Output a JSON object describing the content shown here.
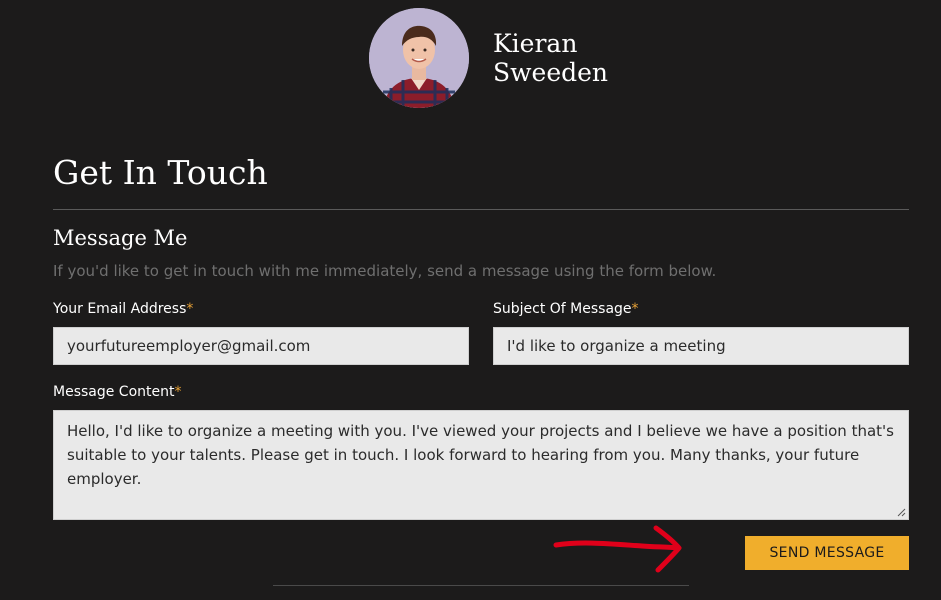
{
  "profile": {
    "name": "Kieran Sweeden"
  },
  "contact": {
    "title": "Get In Touch",
    "subtitle": "Message Me",
    "intro": "If you'd like to get in touch with me immediately, send a message using the form below.",
    "required_marker": "*",
    "email": {
      "label": "Your Email Address",
      "value": "yourfutureemployer@gmail.com"
    },
    "subject": {
      "label": "Subject Of Message",
      "value": "I'd like to organize a meeting"
    },
    "message": {
      "label": "Message Content",
      "value": "Hello, I'd like to organize a meeting with you. I've viewed your projects and I believe we have a position that's suitable to your talents. Please get in touch. I look forward to hearing from you. Many thanks, your future employer."
    },
    "send_label": "SEND MESSAGE"
  },
  "colors": {
    "background": "#1c1b1b",
    "accent": "#f0ae2c",
    "required": "#e8a236",
    "annotation": "#e0001a"
  }
}
